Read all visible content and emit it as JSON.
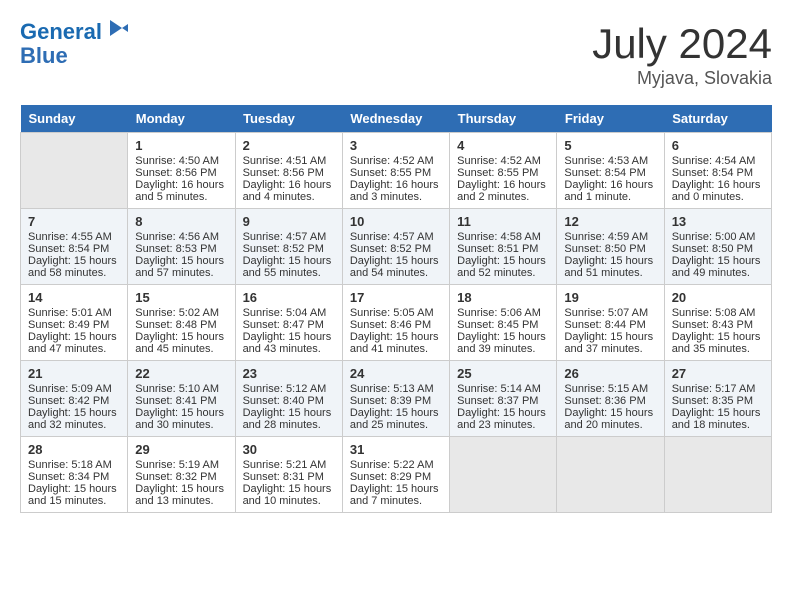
{
  "header": {
    "logo_line1": "General",
    "logo_line2": "Blue",
    "month": "July 2024",
    "location": "Myjava, Slovakia"
  },
  "weekdays": [
    "Sunday",
    "Monday",
    "Tuesday",
    "Wednesday",
    "Thursday",
    "Friday",
    "Saturday"
  ],
  "weeks": [
    [
      {
        "day": "",
        "empty": true
      },
      {
        "day": "1",
        "sunrise": "Sunrise: 4:50 AM",
        "sunset": "Sunset: 8:56 PM",
        "daylight": "Daylight: 16 hours and 5 minutes."
      },
      {
        "day": "2",
        "sunrise": "Sunrise: 4:51 AM",
        "sunset": "Sunset: 8:56 PM",
        "daylight": "Daylight: 16 hours and 4 minutes."
      },
      {
        "day": "3",
        "sunrise": "Sunrise: 4:52 AM",
        "sunset": "Sunset: 8:55 PM",
        "daylight": "Daylight: 16 hours and 3 minutes."
      },
      {
        "day": "4",
        "sunrise": "Sunrise: 4:52 AM",
        "sunset": "Sunset: 8:55 PM",
        "daylight": "Daylight: 16 hours and 2 minutes."
      },
      {
        "day": "5",
        "sunrise": "Sunrise: 4:53 AM",
        "sunset": "Sunset: 8:54 PM",
        "daylight": "Daylight: 16 hours and 1 minute."
      },
      {
        "day": "6",
        "sunrise": "Sunrise: 4:54 AM",
        "sunset": "Sunset: 8:54 PM",
        "daylight": "Daylight: 16 hours and 0 minutes."
      }
    ],
    [
      {
        "day": "7",
        "sunrise": "Sunrise: 4:55 AM",
        "sunset": "Sunset: 8:54 PM",
        "daylight": "Daylight: 15 hours and 58 minutes."
      },
      {
        "day": "8",
        "sunrise": "Sunrise: 4:56 AM",
        "sunset": "Sunset: 8:53 PM",
        "daylight": "Daylight: 15 hours and 57 minutes."
      },
      {
        "day": "9",
        "sunrise": "Sunrise: 4:57 AM",
        "sunset": "Sunset: 8:52 PM",
        "daylight": "Daylight: 15 hours and 55 minutes."
      },
      {
        "day": "10",
        "sunrise": "Sunrise: 4:57 AM",
        "sunset": "Sunset: 8:52 PM",
        "daylight": "Daylight: 15 hours and 54 minutes."
      },
      {
        "day": "11",
        "sunrise": "Sunrise: 4:58 AM",
        "sunset": "Sunset: 8:51 PM",
        "daylight": "Daylight: 15 hours and 52 minutes."
      },
      {
        "day": "12",
        "sunrise": "Sunrise: 4:59 AM",
        "sunset": "Sunset: 8:50 PM",
        "daylight": "Daylight: 15 hours and 51 minutes."
      },
      {
        "day": "13",
        "sunrise": "Sunrise: 5:00 AM",
        "sunset": "Sunset: 8:50 PM",
        "daylight": "Daylight: 15 hours and 49 minutes."
      }
    ],
    [
      {
        "day": "14",
        "sunrise": "Sunrise: 5:01 AM",
        "sunset": "Sunset: 8:49 PM",
        "daylight": "Daylight: 15 hours and 47 minutes."
      },
      {
        "day": "15",
        "sunrise": "Sunrise: 5:02 AM",
        "sunset": "Sunset: 8:48 PM",
        "daylight": "Daylight: 15 hours and 45 minutes."
      },
      {
        "day": "16",
        "sunrise": "Sunrise: 5:04 AM",
        "sunset": "Sunset: 8:47 PM",
        "daylight": "Daylight: 15 hours and 43 minutes."
      },
      {
        "day": "17",
        "sunrise": "Sunrise: 5:05 AM",
        "sunset": "Sunset: 8:46 PM",
        "daylight": "Daylight: 15 hours and 41 minutes."
      },
      {
        "day": "18",
        "sunrise": "Sunrise: 5:06 AM",
        "sunset": "Sunset: 8:45 PM",
        "daylight": "Daylight: 15 hours and 39 minutes."
      },
      {
        "day": "19",
        "sunrise": "Sunrise: 5:07 AM",
        "sunset": "Sunset: 8:44 PM",
        "daylight": "Daylight: 15 hours and 37 minutes."
      },
      {
        "day": "20",
        "sunrise": "Sunrise: 5:08 AM",
        "sunset": "Sunset: 8:43 PM",
        "daylight": "Daylight: 15 hours and 35 minutes."
      }
    ],
    [
      {
        "day": "21",
        "sunrise": "Sunrise: 5:09 AM",
        "sunset": "Sunset: 8:42 PM",
        "daylight": "Daylight: 15 hours and 32 minutes."
      },
      {
        "day": "22",
        "sunrise": "Sunrise: 5:10 AM",
        "sunset": "Sunset: 8:41 PM",
        "daylight": "Daylight: 15 hours and 30 minutes."
      },
      {
        "day": "23",
        "sunrise": "Sunrise: 5:12 AM",
        "sunset": "Sunset: 8:40 PM",
        "daylight": "Daylight: 15 hours and 28 minutes."
      },
      {
        "day": "24",
        "sunrise": "Sunrise: 5:13 AM",
        "sunset": "Sunset: 8:39 PM",
        "daylight": "Daylight: 15 hours and 25 minutes."
      },
      {
        "day": "25",
        "sunrise": "Sunrise: 5:14 AM",
        "sunset": "Sunset: 8:37 PM",
        "daylight": "Daylight: 15 hours and 23 minutes."
      },
      {
        "day": "26",
        "sunrise": "Sunrise: 5:15 AM",
        "sunset": "Sunset: 8:36 PM",
        "daylight": "Daylight: 15 hours and 20 minutes."
      },
      {
        "day": "27",
        "sunrise": "Sunrise: 5:17 AM",
        "sunset": "Sunset: 8:35 PM",
        "daylight": "Daylight: 15 hours and 18 minutes."
      }
    ],
    [
      {
        "day": "28",
        "sunrise": "Sunrise: 5:18 AM",
        "sunset": "Sunset: 8:34 PM",
        "daylight": "Daylight: 15 hours and 15 minutes."
      },
      {
        "day": "29",
        "sunrise": "Sunrise: 5:19 AM",
        "sunset": "Sunset: 8:32 PM",
        "daylight": "Daylight: 15 hours and 13 minutes."
      },
      {
        "day": "30",
        "sunrise": "Sunrise: 5:21 AM",
        "sunset": "Sunset: 8:31 PM",
        "daylight": "Daylight: 15 hours and 10 minutes."
      },
      {
        "day": "31",
        "sunrise": "Sunrise: 5:22 AM",
        "sunset": "Sunset: 8:29 PM",
        "daylight": "Daylight: 15 hours and 7 minutes."
      },
      {
        "day": "",
        "empty": true
      },
      {
        "day": "",
        "empty": true
      },
      {
        "day": "",
        "empty": true
      }
    ]
  ]
}
